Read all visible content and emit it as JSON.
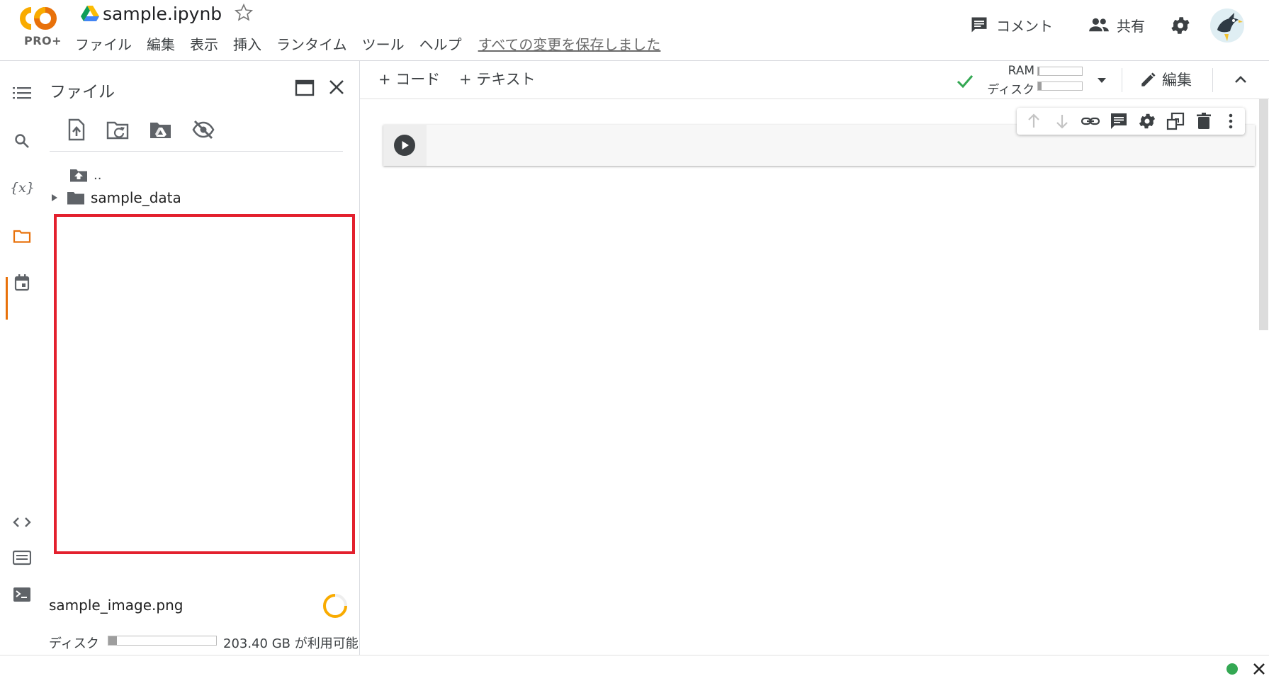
{
  "header": {
    "logo_text": "PRO+",
    "notebook_title": "sample.ipynb",
    "menu": [
      "ファイル",
      "編集",
      "表示",
      "挿入",
      "ランタイム",
      "ツール",
      "ヘルプ"
    ],
    "save_status": "すべての変更を保存しました",
    "comment_label": "コメント",
    "share_label": "共有"
  },
  "file_panel": {
    "title": "ファイル",
    "parent_dir": "..",
    "folder_name": "sample_data",
    "upload_file": "sample_image.png",
    "disk_label": "ディスク",
    "disk_free": "203.40 GB が利用可能",
    "disk_used_fraction": 0.08
  },
  "toolbar": {
    "add_code": "+ コード",
    "add_text": "+ テキスト",
    "ram_label": "RAM",
    "disk_label": "ディスク",
    "ram_fraction": 0.04,
    "disk_fraction": 0.08,
    "edit_label": "編集"
  },
  "colors": {
    "accent_orange": "#e8710a",
    "drop_box_red": "#e3202e",
    "connected_green": "#34a853"
  }
}
